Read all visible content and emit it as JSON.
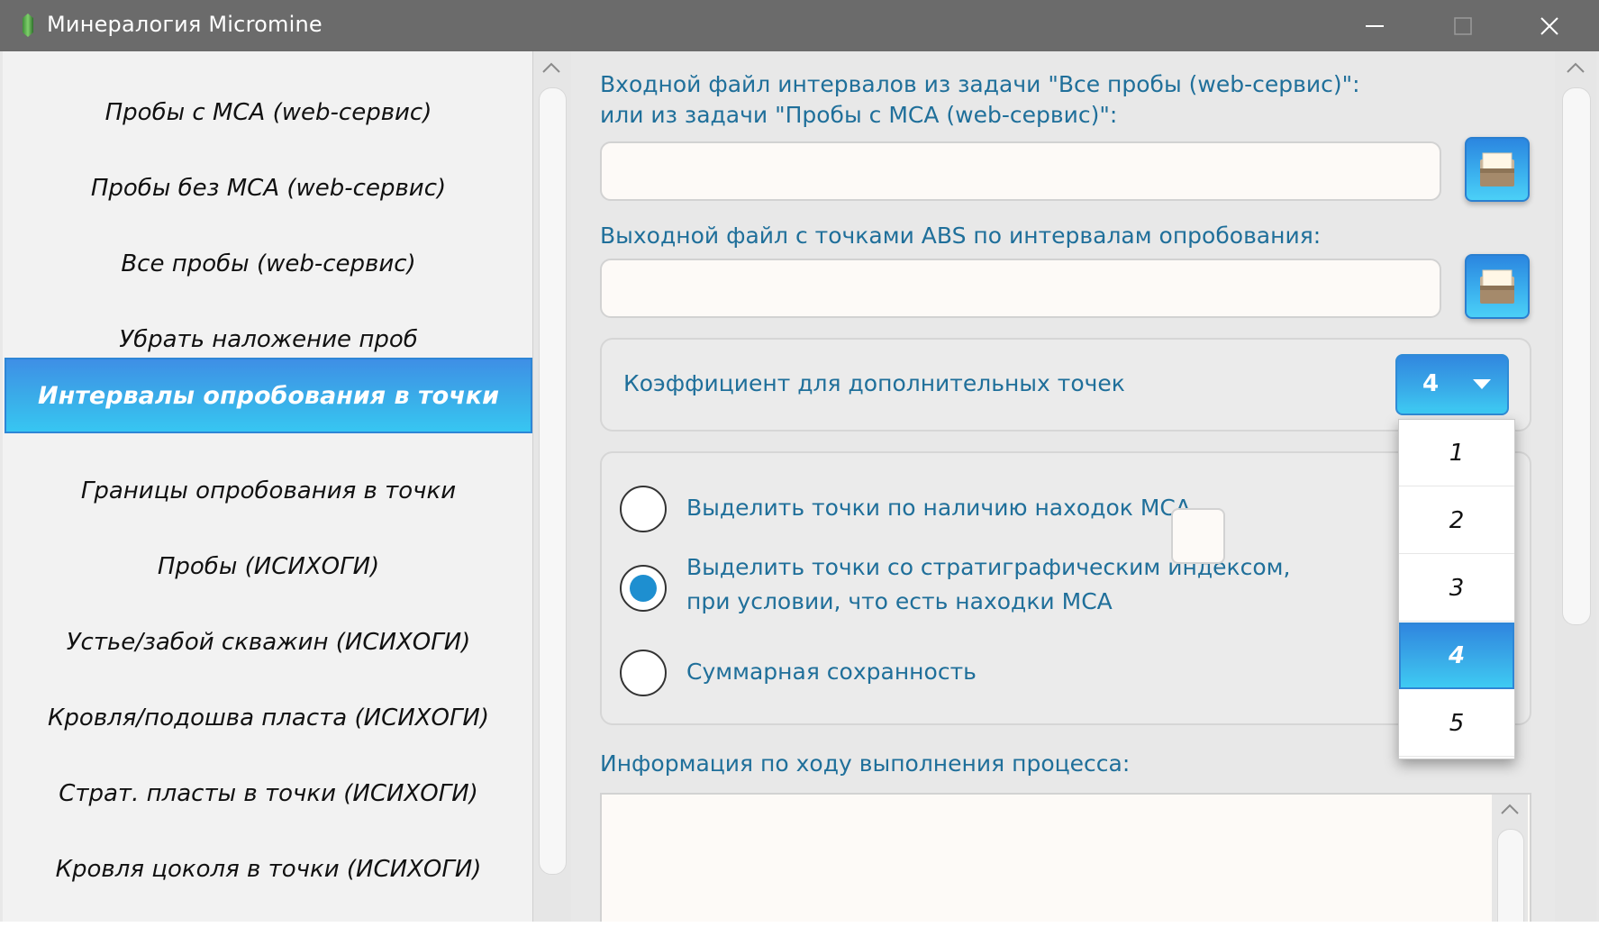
{
  "window": {
    "title": "Минералогия Micromine",
    "icon": "green-crystal-icon"
  },
  "nav": {
    "items": [
      {
        "label": "Пробы с МСА (web-сервис)"
      },
      {
        "label": "Пробы без МСА (web-сервис)"
      },
      {
        "label": "Все пробы (web-сервис)"
      },
      {
        "label": "Убрать наложение проб"
      },
      {
        "label": "Интервалы опробования в точки",
        "active": true
      },
      {
        "label": "Границы опробования в точки"
      },
      {
        "label": "Пробы (ИСИХОГИ)"
      },
      {
        "label": "Устье/забой скважин (ИСИХОГИ)"
      },
      {
        "label": "Кровля/подошва пласта (ИСИХОГИ)"
      },
      {
        "label": "Страт. пласты в точки (ИСИХОГИ)"
      },
      {
        "label": "Кровля цоколя в точки (ИСИХОГИ)"
      }
    ]
  },
  "main": {
    "input_file_label_line1": "Входной файл интервалов из задачи \"Все пробы (web-сервис)\":",
    "input_file_label_line2": "или из задачи \"Пробы с МСА (web-сервис)\":",
    "input_file_value": "",
    "output_file_label": "Выходной файл с точками ABS по интервалам опробования:",
    "output_file_value": "",
    "coefficient_label": "Коэффициент для дополнительных точек",
    "coefficient_value": "4",
    "coefficient_options": [
      "1",
      "2",
      "3",
      "4",
      "5"
    ],
    "coefficient_selected_index": 3,
    "options": [
      {
        "label": "Выделить точки по наличию находок МСА",
        "checked": false
      },
      {
        "label_line1": "Выделить точки со стратиграфическим индексом,",
        "label_line2": "при условии, что есть находки МСА",
        "checked": true
      },
      {
        "label": "Суммарная сохранность",
        "checked": false
      }
    ],
    "strat_index_value": "",
    "info_label": "Информация по ходу выполнения процесса:",
    "info_text": ""
  },
  "colors": {
    "accent": "#3aaee9",
    "label_text": "#1f6f9a",
    "titlebar": "#6b6b6b",
    "radio_fill": "#1e8fd0"
  }
}
